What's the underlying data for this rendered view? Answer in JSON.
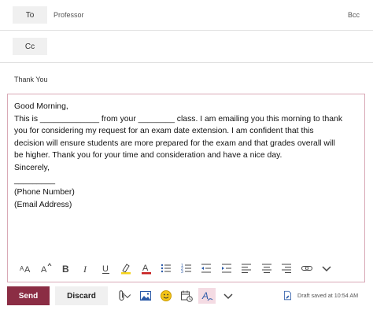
{
  "compose": {
    "to_label": "To",
    "to_value": "Professor",
    "bcc_label": "Bcc",
    "cc_label": "Cc",
    "subject": "Thank You",
    "body_lines": [
      "Good Morning,",
      "This is _____________ from your ________ class. I am emailing you this morning to thank",
      "you for considering my request for an exam date extension. I am confident that this",
      "decision will ensure students are more prepared for the exam and that grades overall will",
      "be higher. Thank you for your time and consideration and have a nice day.",
      "Sincerely,",
      "_________",
      "(Phone Number)",
      "(Email Address)"
    ]
  },
  "toolbar_icons": [
    "font-size-icon",
    "grow-font-icon",
    "bold-icon",
    "italic-icon",
    "underline-icon",
    "highlight-icon",
    "font-color-icon",
    "bullets-icon",
    "numbering-icon",
    "decrease-indent-icon",
    "increase-indent-icon",
    "align-left-icon",
    "align-center-icon",
    "align-right-icon",
    "link-icon",
    "more-options-icon"
  ],
  "actions": {
    "send_label": "Send",
    "discard_label": "Discard",
    "draft_status": "Draft saved at 10:54 AM"
  },
  "colors": {
    "send_bg": "#8b2d44",
    "body_border": "#d9a9b6",
    "font_color_red": "#c81e1e",
    "highlight_yellow": "#f5d21a",
    "editor_icon_bg": "#f4dbe3"
  }
}
